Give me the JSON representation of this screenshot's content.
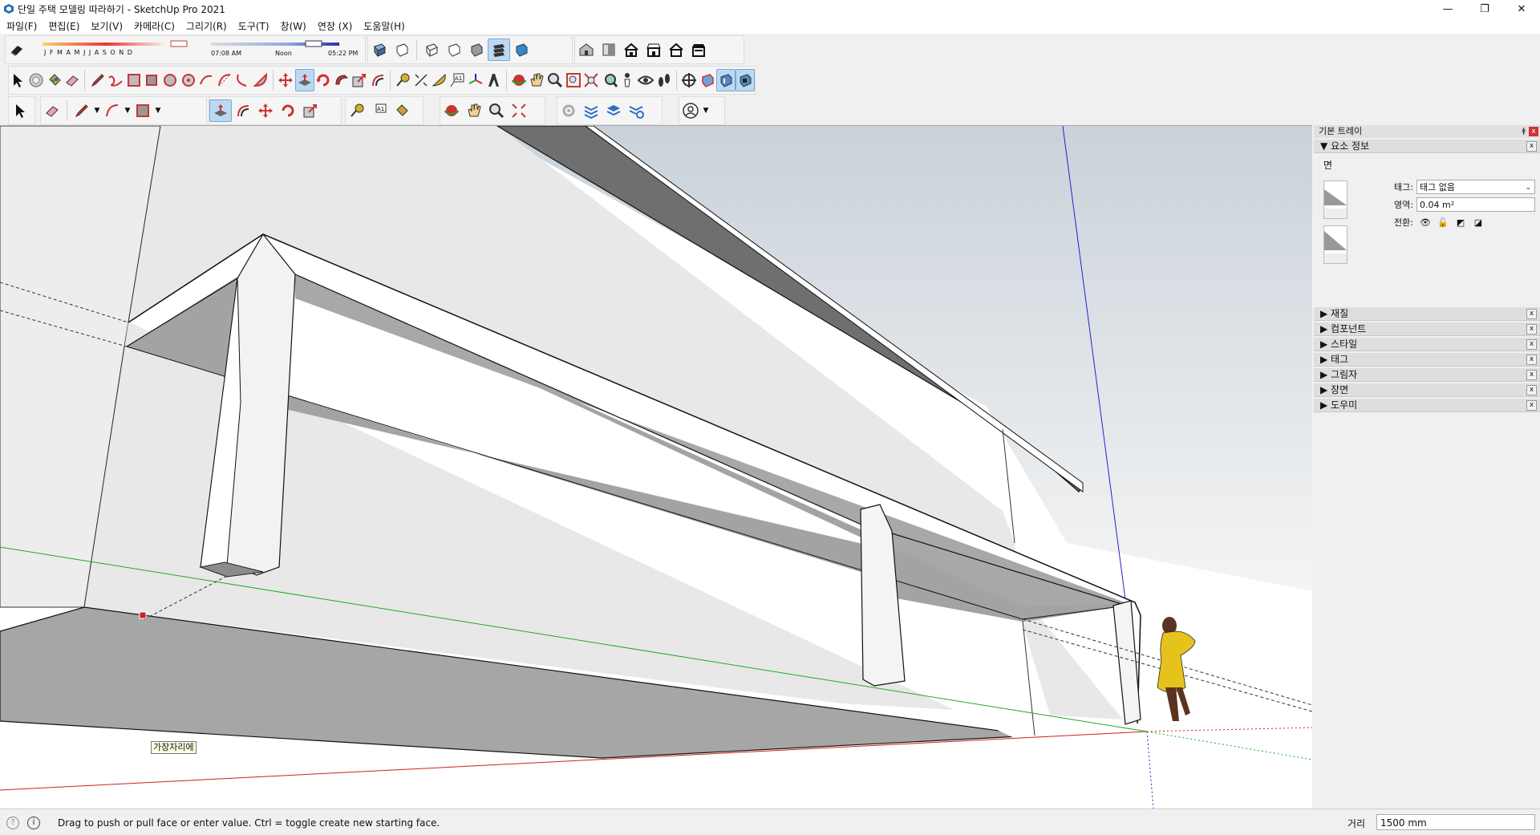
{
  "window": {
    "title": "단일 주택 모델링 따라하기 - SketchUp Pro 2021",
    "controls": [
      "—",
      "❐",
      "✕"
    ]
  },
  "menu": [
    "파일(F)",
    "편집(E)",
    "보기(V)",
    "카메라(C)",
    "그리기(R)",
    "도구(T)",
    "창(W)",
    "연장 (X)",
    "도움말(H)"
  ],
  "shadow": {
    "months": "J  F  M  A  M  J  J  A  S  O  N  D",
    "time_start": "07:08 AM",
    "time_mid": "Noon",
    "time_end": "05:22 PM"
  },
  "tooltip": "가장자리에",
  "tray": {
    "title": "기본 트레이",
    "pin": "ǂ",
    "entity_info": {
      "header": "요소 정보",
      "type": "면",
      "tag_label": "태그:",
      "tag_value": "태그 없음",
      "area_label": "영역:",
      "area_value": "0.04 m²",
      "toggle_label": "전환:"
    },
    "panels": [
      "재질",
      "컴포넌트",
      "스타일",
      "태그",
      "그림자",
      "장면",
      "도우미"
    ]
  },
  "status": {
    "message": "Drag to push or pull face or enter value.  Ctrl = toggle create new starting face.",
    "distance_label": "거리",
    "distance_value": "1500 mm"
  },
  "colors": {
    "accent": "#bcd9f2",
    "face_dark": "#6e6e6e",
    "face_mid": "#a3a3a3",
    "face_light": "#e6e6e6",
    "axis_red": "#cc2222",
    "axis_green": "#22aa22",
    "axis_blue": "#2222cc"
  }
}
